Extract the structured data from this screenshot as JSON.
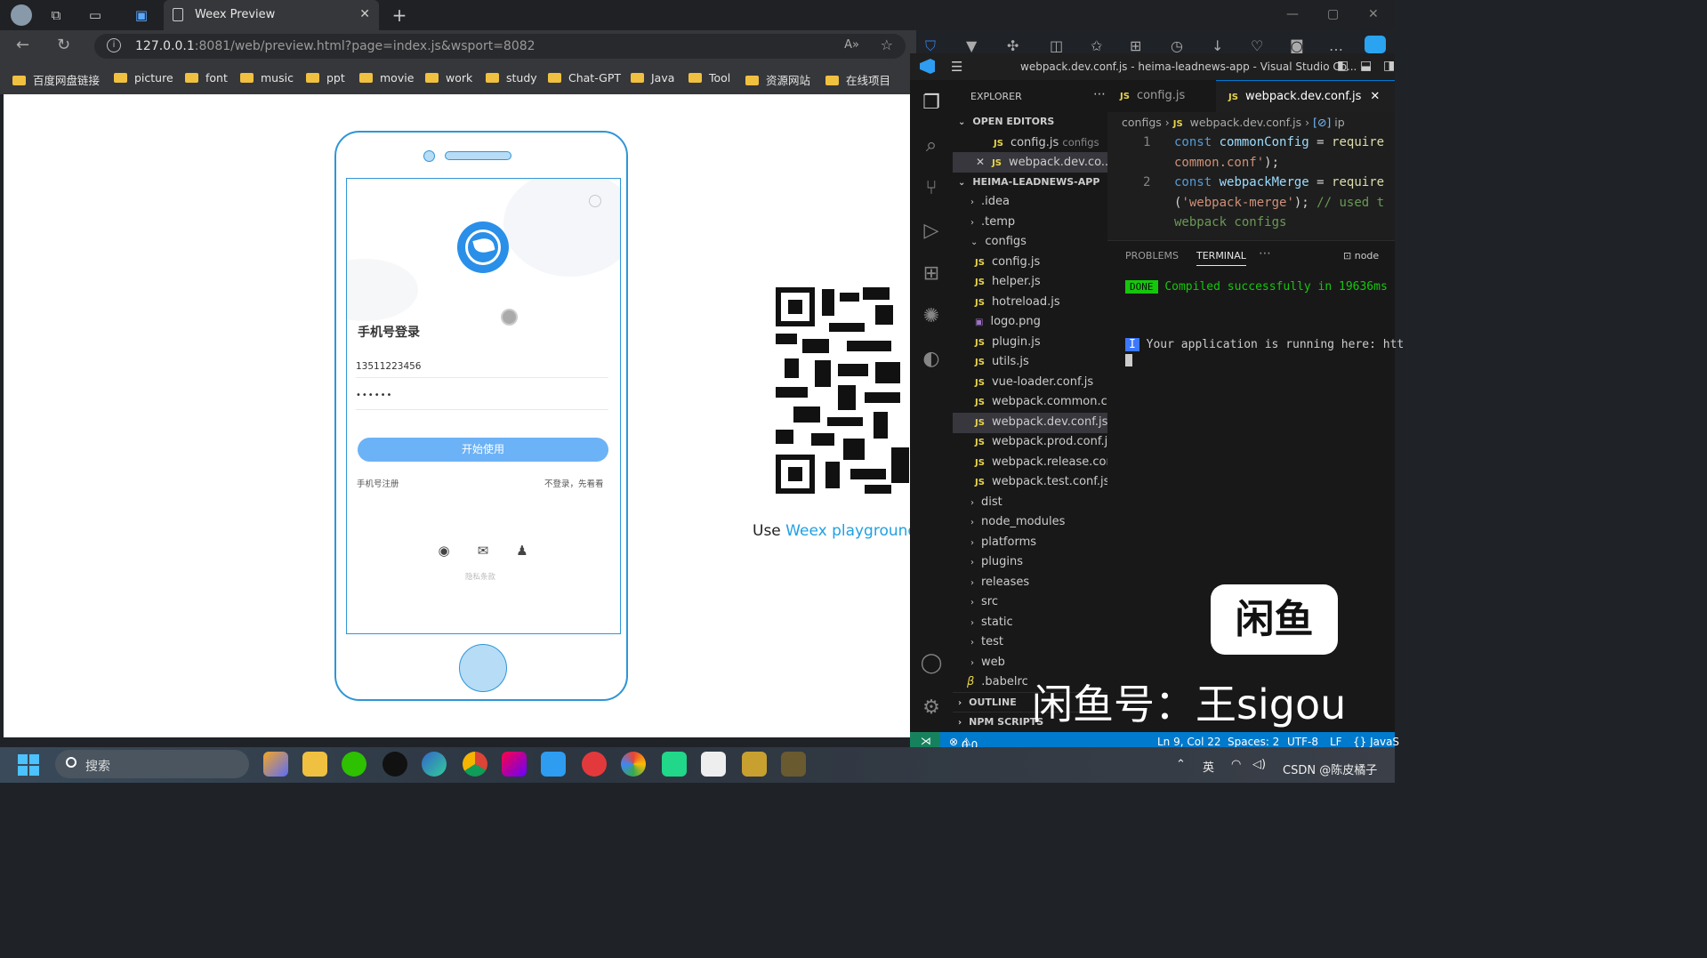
{
  "browser": {
    "tab_title": "Weex Preview",
    "url_host": "127.0.0.1",
    "url_rest": ":8081/web/preview.html?page=index.js&wsport=8082",
    "bookmarks": [
      "百度网盘链接",
      "picture",
      "font",
      "music",
      "ppt",
      "movie",
      "work",
      "study",
      "Chat-GPT",
      "Java",
      "Tool",
      "资源网站",
      "在线项目"
    ]
  },
  "app": {
    "login_title": "手机号登录",
    "phone_value": "13511223456",
    "password_value": "••••••",
    "start_button": "开始使用",
    "register_link": "手机号注册",
    "guest_link": "不登录，先看看",
    "privacy": "隐私条款"
  },
  "preview": {
    "use_prefix": "Use ",
    "use_link": "Weex playground"
  },
  "vscode": {
    "title": "webpack.dev.conf.js - heima-leadnews-app - Visual Studio Co...",
    "explorer_label": "EXPLORER",
    "open_editors_label": "OPEN EDITORS",
    "open_editors": [
      {
        "name": "config.js",
        "folder": "configs"
      },
      {
        "name": "webpack.dev.co...",
        "folder": ""
      }
    ],
    "project_label": "HEIMA-LEADNEWS-APP",
    "tree": {
      "idea": ".idea",
      "temp": ".temp",
      "configs": "configs",
      "config_files": [
        "config.js",
        "helper.js",
        "hotreload.js",
        "logo.png",
        "plugin.js",
        "utils.js",
        "vue-loader.conf.js",
        "webpack.common.c...",
        "webpack.dev.conf.js",
        "webpack.prod.conf.js",
        "webpack.release.con...",
        "webpack.test.conf.js"
      ],
      "folders": [
        "dist",
        "node_modules",
        "platforms",
        "plugins",
        "releases",
        "src",
        "static",
        "test",
        "web"
      ],
      "babelrc": ".babelrc"
    },
    "outline_label": "OUTLINE",
    "npm_label": "NPM SCRIPTS",
    "tabs": [
      "config.js",
      "webpack.dev.conf.js"
    ],
    "breadcrumb": {
      "folder": "configs",
      "file": "webpack.dev.conf.js",
      "symbol": "ip"
    },
    "code": {
      "ln1": "1",
      "ln2": "2",
      "l1_kw": "const",
      "l1_var": "commonConfig",
      "l1_eq": " = ",
      "l1_fn": "require",
      "l1b_str": "common.conf'",
      "l1b_end": ");",
      "l2_kw": "const",
      "l2_var": "webpackMerge",
      "l2_eq": " = ",
      "l2_fn": "require",
      "l2b_open": "(",
      "l2b_str": "'webpack-merge'",
      "l2b_end": "); ",
      "l2b_cm": "// used t",
      "l2c_cm": "webpack configs"
    },
    "panel_tabs": [
      "PROBLEMS",
      "TERMINAL"
    ],
    "shell": "node",
    "term_done": "DONE",
    "term_compiled": "Compiled successfully in 19636ms",
    "term_info": "I",
    "term_running": "Your application is running here: htt",
    "status": {
      "errors": "0",
      "warnings": "0",
      "position": "Ln 9, Col 22",
      "spaces": "Spaces: 2",
      "encoding": "UTF-8",
      "eol": "LF",
      "lang": "{} JavaS"
    }
  },
  "watermark": {
    "box": "闲鱼",
    "text": "闲鱼号：王sigou",
    "csdn": "CSDN @陈皮橘子"
  },
  "taskbar": {
    "search": "搜索",
    "ime": "英"
  },
  "colors": {
    "accent_blue": "#2f96d6",
    "button_blue": "#6cb2f6",
    "vscode_status": "#007acc",
    "done_green": "#16c60c"
  }
}
